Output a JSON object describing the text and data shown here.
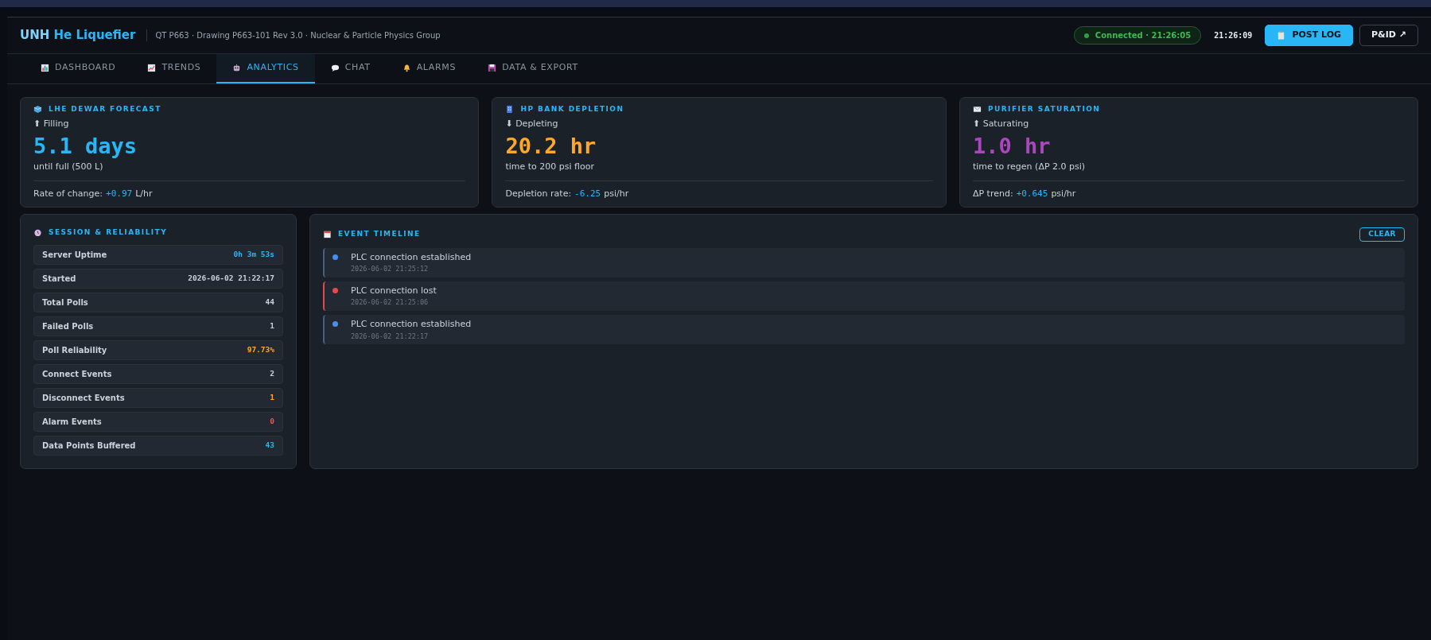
{
  "header": {
    "title_prefix": "UNH",
    "title": "He Liquefier",
    "subtitle": "QT P663 · Drawing P663-101 Rev 3.0 · Nuclear & Particle Physics Group",
    "connection": "Connected · 21:26:05",
    "connected": true,
    "clock": "21:26:09",
    "buttons": [
      {
        "label": "POST LOG",
        "kind": "primary"
      },
      {
        "label": "P&ID ↗",
        "kind": "outline"
      }
    ]
  },
  "tabs": [
    {
      "label": "DASHBOARD",
      "selected": false
    },
    {
      "label": "TRENDS",
      "selected": false
    },
    {
      "label": "ANALYTICS",
      "selected": true
    },
    {
      "label": "CHAT",
      "selected": false
    },
    {
      "label": "ALARMS",
      "selected": false
    },
    {
      "label": "DATA & EXPORT",
      "selected": false
    }
  ],
  "forecasts": [
    {
      "title": "LHE DEWAR FORECAST",
      "trend": "⬆ Filling",
      "value": "5.1 days",
      "color": "#29b6f6",
      "caption": "until full (500 L)",
      "rate_label": "Rate of change:",
      "rate": "+0.97",
      "rate_unit": "L/hr"
    },
    {
      "title": "HP BANK DEPLETION",
      "trend": "⬇ Depleting",
      "value": "20.2 hr",
      "color": "#ffa726",
      "caption": "time to 200 psi floor",
      "rate_label": "Depletion rate:",
      "rate": "-6.25",
      "rate_unit": "psi/hr"
    },
    {
      "title": "PURIFIER SATURATION",
      "trend": "⬆ Saturating",
      "value": "1.0 hr",
      "color": "#ab47bc",
      "caption": "time to regen (ΔP 2.0 psi)",
      "rate_label": "ΔP trend:",
      "rate": "+0.645",
      "rate_unit": "psi/hr"
    }
  ],
  "session": {
    "title": "SESSION & RELIABILITY",
    "rows": [
      {
        "label": "Server Uptime",
        "value": "0h 3m 53s",
        "color": "#29b6f6"
      },
      {
        "label": "Started",
        "value": "2026-06-02 21:22:17",
        "color": "#c9d1d9"
      },
      {
        "label": "Total Polls",
        "value": "44",
        "color": "#c9d1d9"
      },
      {
        "label": "Failed Polls",
        "value": "1",
        "color": "#c9d1d9"
      },
      {
        "label": "Poll Reliability",
        "value": "97.73%",
        "color": "#ffa726"
      },
      {
        "label": "Connect Events",
        "value": "2",
        "color": "#c9d1d9"
      },
      {
        "label": "Disconnect Events",
        "value": "1",
        "color": "#ffa726"
      },
      {
        "label": "Alarm Events",
        "value": "0",
        "color": "#ef5350"
      },
      {
        "label": "Data Points Buffered",
        "value": "43",
        "color": "#29b6f6"
      }
    ]
  },
  "timeline": {
    "title": "EVENT TIMELINE",
    "clear": "CLEAR",
    "events": [
      {
        "text": "PLC connection established",
        "time": "2026-06-02 21:25:12",
        "color": "#4a8fe7"
      },
      {
        "text": "PLC connection lost",
        "time": "2026-06-02 21:25:06",
        "color": "#e5484d"
      },
      {
        "text": "PLC connection established",
        "time": "2026-06-02 21:22:17",
        "color": "#4a8fe7"
      }
    ]
  }
}
